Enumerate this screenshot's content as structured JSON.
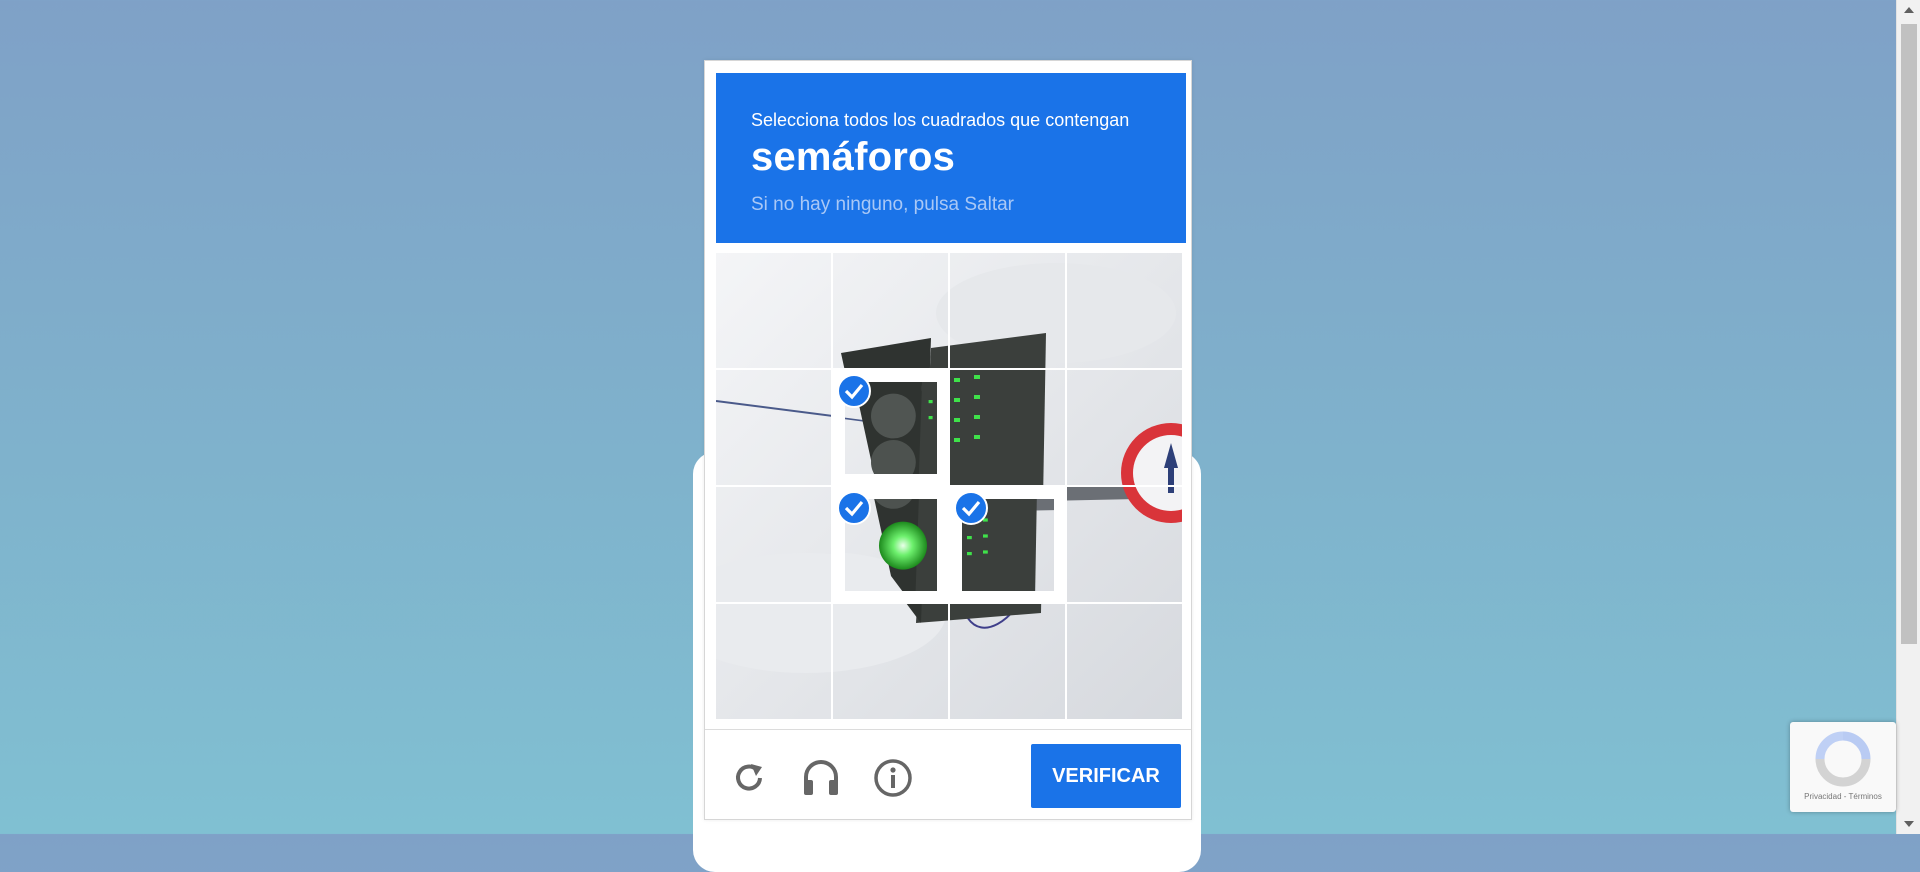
{
  "challenge": {
    "instruction": "Selecciona todos los cuadrados que contengan",
    "keyword": "semáforos",
    "hint": "Si no hay ninguno, pulsa Saltar",
    "tiles": [
      {
        "selected": false
      },
      {
        "selected": false
      },
      {
        "selected": false
      },
      {
        "selected": false
      },
      {
        "selected": false
      },
      {
        "selected": true
      },
      {
        "selected": false
      },
      {
        "selected": false
      },
      {
        "selected": false
      },
      {
        "selected": true
      },
      {
        "selected": true
      },
      {
        "selected": false
      },
      {
        "selected": false
      },
      {
        "selected": false
      },
      {
        "selected": false
      },
      {
        "selected": false
      }
    ],
    "footer": {
      "reload_icon": "reload-icon",
      "audio_icon": "headphones-icon",
      "info_icon": "info-icon",
      "verify_label": "VERIFICAR"
    },
    "colors": {
      "accent": "#1a73e8"
    }
  },
  "badge": {
    "terms": "Privacidad - Términos"
  }
}
